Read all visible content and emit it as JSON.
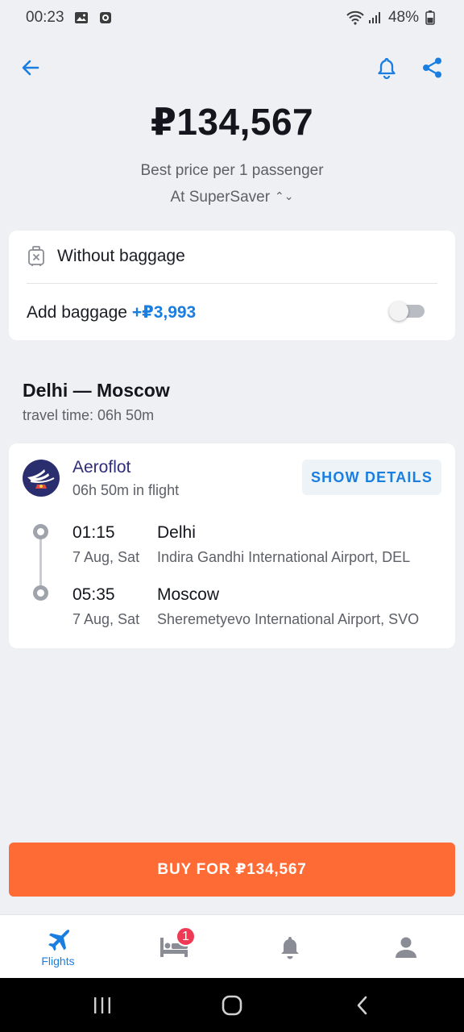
{
  "status_bar": {
    "time": "00:23",
    "battery": "48%"
  },
  "header": {
    "price": "₽134,567",
    "subtitle": "Best price per 1 passenger",
    "agency": "At SuperSaver"
  },
  "baggage": {
    "option": "Without baggage",
    "add_label": "Add baggage",
    "add_price": "+₽3,993",
    "enabled": false
  },
  "route": {
    "title": "Delhi — Moscow",
    "travel_time": "travel time: 06h 50m"
  },
  "flight": {
    "airline": "Aeroflot",
    "duration": "06h 50m in flight",
    "details_button": "SHOW DETAILS",
    "departure": {
      "time": "01:15",
      "date": "7 Aug, Sat",
      "city": "Delhi",
      "airport": "Indira Gandhi International Airport, DEL"
    },
    "arrival": {
      "time": "05:35",
      "date": "7 Aug, Sat",
      "city": "Moscow",
      "airport": "Sheremetyevo International Airport, SVO"
    }
  },
  "buy_button": "BUY FOR ₽134,567",
  "tabbar": {
    "flights_label": "Flights",
    "hotels_badge": "1",
    "active_tab": "flights"
  },
  "colors": {
    "accent": "#1a7ee0",
    "buy": "#ff6b35",
    "badge": "#ef3a55",
    "background": "#eff0f4"
  },
  "icons": [
    "back-arrow-icon",
    "bell-icon",
    "share-icon",
    "suitcase-crossed-icon",
    "airline-logo-icon",
    "plane-icon",
    "bed-icon",
    "bell-icon",
    "person-icon"
  ]
}
